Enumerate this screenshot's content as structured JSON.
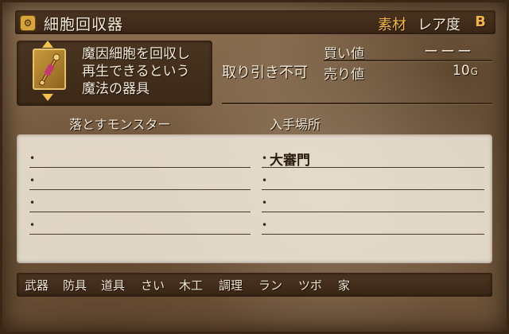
{
  "item": {
    "name": "細胞回収器",
    "category_label": "素材",
    "rarity_label": "レア度",
    "rarity_value": "B",
    "description": [
      "魔因細胞を回収し",
      "再生できるという",
      "魔法の器具"
    ],
    "trade_status": "取り引き不可",
    "buy_label": "買い値",
    "buy_value": "ーーー",
    "sell_label": "売り値",
    "sell_value": "10",
    "sell_unit": "G"
  },
  "info": {
    "monsters_header": "落とすモンスター",
    "location_header": "入手場所",
    "monsters": [
      "",
      "",
      "",
      ""
    ],
    "locations": [
      "大審門",
      "",
      "",
      ""
    ]
  },
  "bottom_tabs": [
    "武器",
    "防具",
    "道具",
    "さい",
    "木工",
    "調理",
    "ラン",
    "ツボ",
    "家"
  ],
  "icons": {
    "title_badge": "item-category-badge-icon",
    "item_icon": "cell-collector-wand-icon"
  },
  "colors": {
    "accent": "#f2b34a",
    "text": "#f3ead8",
    "panel_dark": "#3b2816"
  }
}
